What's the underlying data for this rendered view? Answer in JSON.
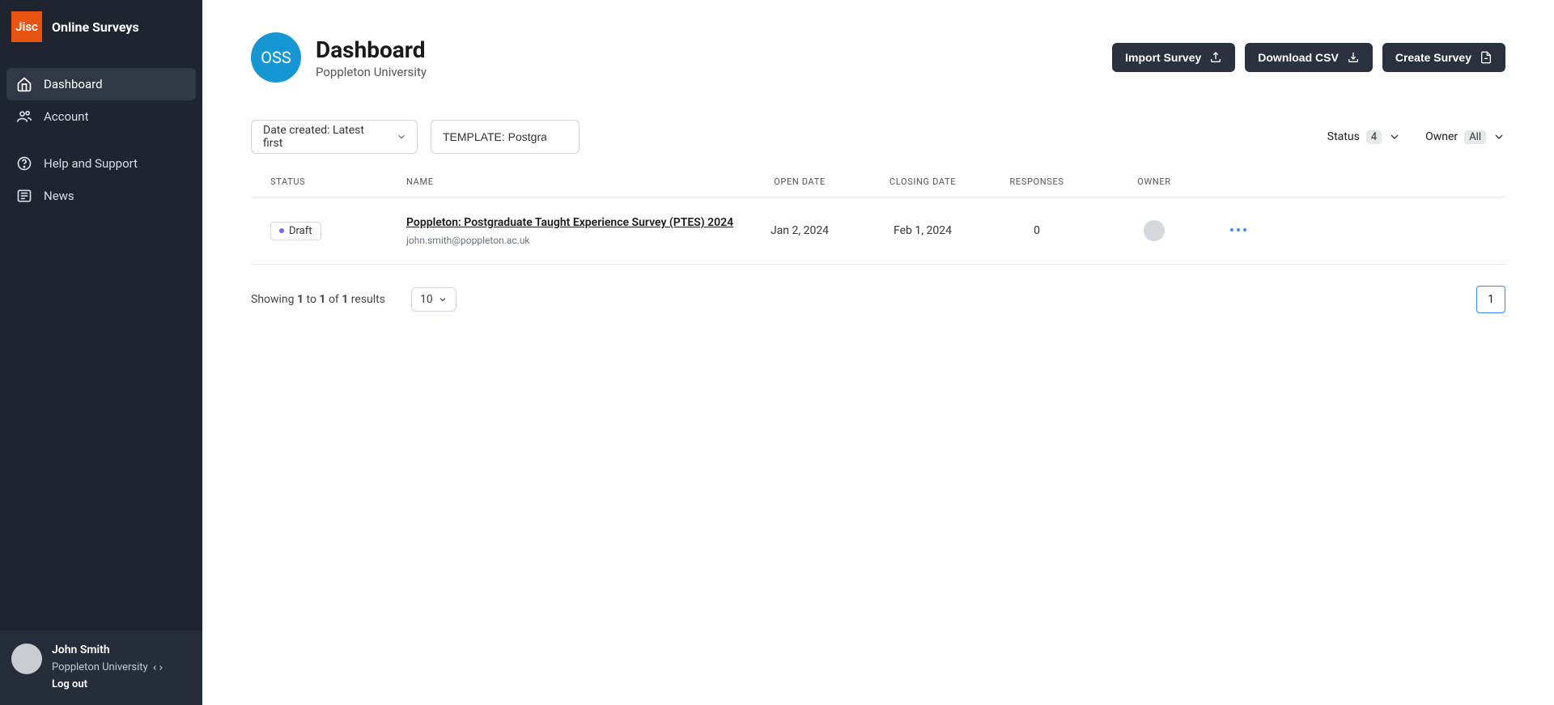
{
  "brand": {
    "logo_text": "Jisc",
    "title": "Online Surveys"
  },
  "sidebar": {
    "items": [
      {
        "label": "Dashboard",
        "icon": "home"
      },
      {
        "label": "Account",
        "icon": "users"
      },
      {
        "label": "Help and Support",
        "icon": "help"
      },
      {
        "label": "News",
        "icon": "news"
      }
    ]
  },
  "user": {
    "name": "John Smith",
    "org": "Poppleton University",
    "logout": "Log out"
  },
  "header": {
    "org_initials": "OSS",
    "title": "Dashboard",
    "subtitle": "Poppleton University",
    "actions": {
      "import": "Import Survey",
      "download": "Download CSV",
      "create": "Create Survey"
    }
  },
  "filters": {
    "sort": "Date created: Latest first",
    "search_value": "TEMPLATE: Postgraduate T",
    "status_label": "Status",
    "status_count": "4",
    "owner_label": "Owner",
    "owner_value": "All"
  },
  "table": {
    "columns": {
      "status": "STATUS",
      "name": "NAME",
      "open": "OPEN DATE",
      "close": "CLOSING DATE",
      "responses": "RESPONSES",
      "owner": "OWNER"
    },
    "rows": [
      {
        "status": "Draft",
        "name": "Poppleton: Postgraduate Taught Experience Survey (PTES) 2024",
        "email": "john.smith@poppleton.ac.uk",
        "open_date": "Jan 2, 2024",
        "close_date": "Feb 1, 2024",
        "responses": "0"
      }
    ]
  },
  "pagination": {
    "showing_prefix": "Showing ",
    "from": "1",
    "to_word": " to ",
    "to": "1",
    "of_word": " of ",
    "total": "1",
    "results_word": " results",
    "page_size": "10",
    "current_page": "1"
  }
}
